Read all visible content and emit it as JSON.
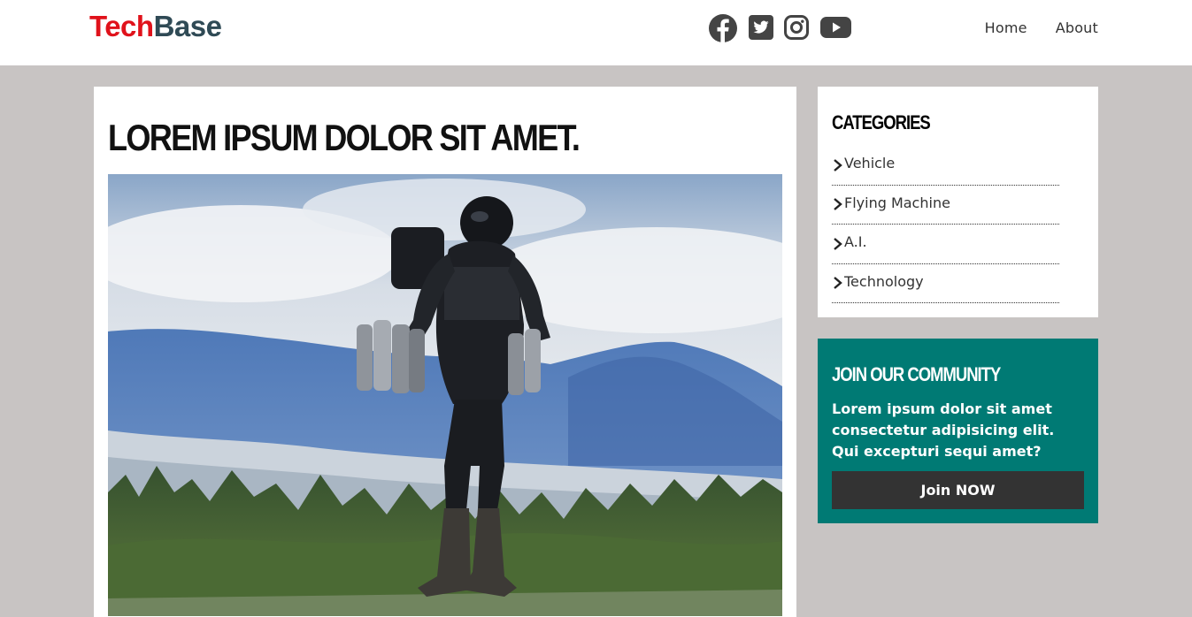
{
  "header": {
    "logo_part1": "Tech",
    "logo_part2": "Base",
    "logo_colors": {
      "part1": "#e0121b",
      "part2": "#2f4a55"
    },
    "social_icons": [
      "facebook-icon",
      "twitter-icon",
      "instagram-icon",
      "youtube-icon"
    ],
    "nav": [
      {
        "label": "Home"
      },
      {
        "label": "About"
      }
    ]
  },
  "post": {
    "title": "LOREM IPSUM DOLOR SIT AMET.",
    "image_alt": "jetpack-flyer-photo"
  },
  "sidebar": {
    "categories": {
      "title": "CATEGORIES",
      "items": [
        {
          "label": "Vehicle"
        },
        {
          "label": "Flying Machine"
        },
        {
          "label": "A.I."
        },
        {
          "label": "Technology"
        }
      ]
    },
    "community": {
      "title": "JOIN OUR COMMUNITY",
      "text": "Lorem ipsum dolor sit amet consectetur adipisicing elit. Qui excepturi sequi amet?",
      "button_label": "Join NOW",
      "background": "#007a74",
      "button_color": "#333333"
    }
  },
  "colors": {
    "page_background": "#c8c4c3",
    "card_background": "#ffffff"
  }
}
